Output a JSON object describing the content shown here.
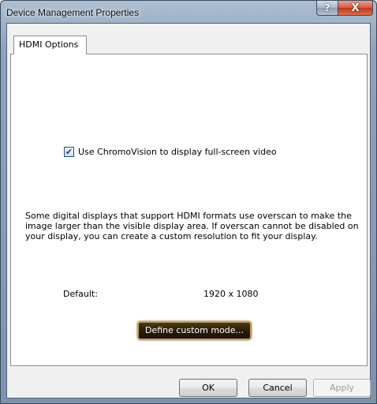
{
  "window": {
    "title": "Device Management Properties",
    "help_glyph": "?",
    "close_glyph": "X"
  },
  "tabs": [
    {
      "label": "HDMI Options",
      "selected": true
    }
  ],
  "options": {
    "checkbox_label": "Use ChromoVision to display full-screen video",
    "checkbox_checked": true,
    "checkbox_glyph": "✔",
    "description": "Some digital displays that support HDMI formats use overscan to make the image larger than the visible display area. If overscan cannot be disabled on your display, you can create a custom resolution to fit your display.",
    "default_label": "Default:",
    "default_value": "1920 x 1080",
    "define_button": "Define custom mode..."
  },
  "buttons": {
    "ok": "OK",
    "cancel": "Cancel",
    "apply": "Apply",
    "apply_enabled": false
  }
}
